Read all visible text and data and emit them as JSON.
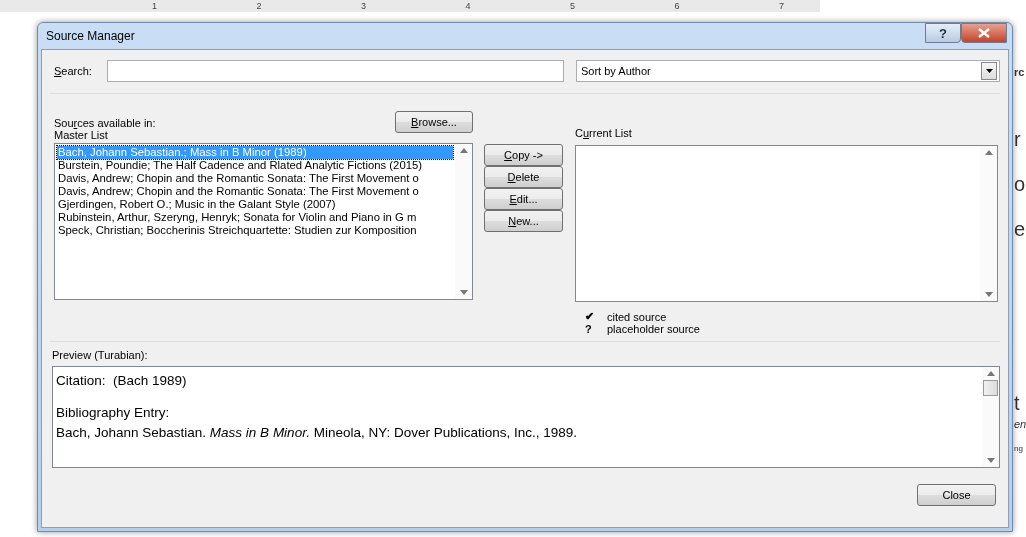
{
  "ruler": {
    "numbers": [
      "1",
      "2",
      "3",
      "4",
      "5",
      "6",
      "7"
    ]
  },
  "document_fragments": [
    {
      "text": "rc",
      "kind": "bold"
    },
    {
      "text": "r",
      "kind": "large"
    },
    {
      "text": "o",
      "kind": "large"
    },
    {
      "text": "e",
      "kind": "large"
    },
    {
      "text": "t",
      "kind": "large"
    },
    {
      "text": "en",
      "kind": "italic"
    },
    {
      "text": "ng",
      "kind": "small"
    }
  ],
  "window": {
    "title": "Source Manager",
    "help_symbol": "?"
  },
  "search": {
    "label": {
      "key": "S",
      "rest": "earch:"
    }
  },
  "sort": {
    "value": "Sort by Author"
  },
  "sources_label": {
    "lead": "Sou",
    "key": "r",
    "rest": "ces available in:"
  },
  "master_list": {
    "title": "Master List",
    "items": [
      {
        "text": "Bach, Johann Sebastian.; Mass in B Minor (1989)",
        "selected": true
      },
      {
        "text": "Burstein, Poundie; The Half Cadence and Rlated Analytic Fictions (2015)",
        "selected": false
      },
      {
        "text": "Davis, Andrew; Chopin and the Romantic Sonata: The First Movement o",
        "selected": false
      },
      {
        "text": "Davis, Andrew; Chopin and the Romantic Sonata: The First Movement o",
        "selected": false
      },
      {
        "text": "Gjerdingen, Robert O.; Music in the Galant Style (2007)",
        "selected": false
      },
      {
        "text": "Rubinstein, Arthur, Szeryng, Henryk; Sonata for Violin and Piano in G m",
        "selected": false
      },
      {
        "text": "Speck, Christian; Boccherinis Streichquartette: Studien zur Komposition",
        "selected": false
      }
    ]
  },
  "browse_button": {
    "key": "B",
    "rest": "rowse..."
  },
  "action_buttons": [
    {
      "key": "C",
      "rest": "opy ->"
    },
    {
      "key": "D",
      "rest": "elete"
    },
    {
      "key": "E",
      "rest": "dit..."
    },
    {
      "key": "N",
      "rest": "ew..."
    }
  ],
  "current_list": {
    "title": {
      "lead": "C",
      "key": "u",
      "rest": "rrent List"
    }
  },
  "legend": [
    {
      "symbol": "✔",
      "text": "cited source"
    },
    {
      "symbol": "?",
      "text": "placeholder source"
    }
  ],
  "preview": {
    "title": "Preview (Turabian):",
    "citation": "Citation:  (Bach 1989)",
    "bibliography": [
      "Bibliography Entry:",
      "Bach, Johann Sebastian. *Mass in B Minor.* Mineola, NY: Dover Publications, Inc., 1989."
    ]
  },
  "close_button": "Close"
}
